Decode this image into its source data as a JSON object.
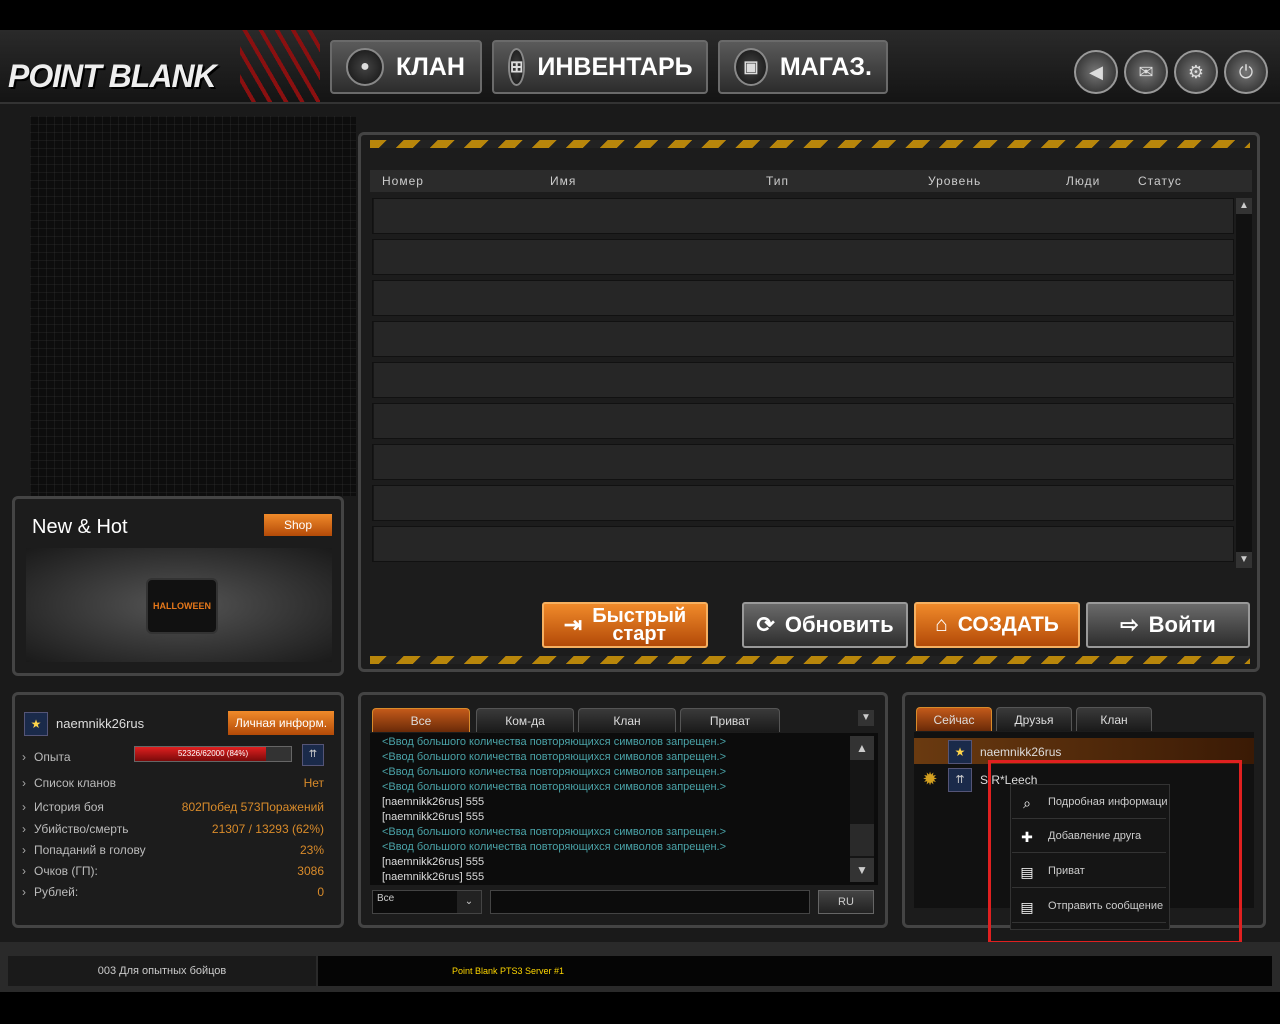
{
  "header": {
    "logo": "POINT BLANK",
    "nav": [
      {
        "label": "КЛАН",
        "icon": "user-icon"
      },
      {
        "label": "ИНВЕНТАРЬ",
        "icon": "cart-icon"
      },
      {
        "label": "МАГАЗ.",
        "icon": "briefcase-icon"
      }
    ],
    "round_buttons": [
      "back-arrow-icon",
      "mail-icon",
      "gear-icon",
      "power-icon"
    ]
  },
  "room_list": {
    "columns": [
      "Номер",
      "Имя",
      "Тип",
      "Уровень",
      "Люди",
      "Статус"
    ]
  },
  "actions": {
    "quick_start_line1": "Быстрый",
    "quick_start_line2": "старт",
    "refresh": "Обновить",
    "create": "СОЗДАТЬ",
    "enter": "Войти"
  },
  "new_hot": {
    "title": "New & Hot",
    "shop_button": "Shop",
    "banner_text": "HALLOWEEN"
  },
  "player": {
    "name": "naemnikk26rus",
    "info_button": "Личная информ.",
    "stats": [
      {
        "label": "Опыта",
        "value": ""
      },
      {
        "label": "Список кланов",
        "value": "Нет"
      },
      {
        "label": "История боя",
        "value": "802Побед 573Поражений"
      },
      {
        "label": "Убийство/смерть",
        "value": "21307 / 13293 (62%)"
      },
      {
        "label": "Попаданий в голову",
        "value": "23%"
      },
      {
        "label": "Очков (ГП):",
        "value": "3086"
      },
      {
        "label": "Рублей:",
        "value": "0"
      }
    ],
    "exp_text": "52326/62000 (84%)",
    "exp_fraction": 0.84
  },
  "chat": {
    "tabs": [
      "Все",
      "Ком-да",
      "Клан",
      "Приват"
    ],
    "lines": [
      {
        "text": "<Ввод большого количества повторяющихся символов запрещен.>",
        "type": "sys"
      },
      {
        "text": "<Ввод большого количества повторяющихся символов запрещен.>",
        "type": "sys"
      },
      {
        "text": "<Ввод большого количества повторяющихся символов запрещен.>",
        "type": "sys"
      },
      {
        "text": "<Ввод большого количества повторяющихся символов запрещен.>",
        "type": "sys"
      },
      {
        "text": "[naemnikk26rus] 555",
        "type": "user"
      },
      {
        "text": "[naemnikk26rus] 555",
        "type": "user"
      },
      {
        "text": "<Ввод большого количества повторяющихся символов запрещен.>",
        "type": "sys"
      },
      {
        "text": "<Ввод большого количества повторяющихся символов запрещен.>",
        "type": "sys"
      },
      {
        "text": "[naemnikk26rus] 555",
        "type": "user"
      },
      {
        "text": "[naemnikk26rus] 555",
        "type": "user"
      }
    ],
    "channel_select": "Все",
    "lang_button": "RU"
  },
  "friends": {
    "tabs": [
      "Сейчас",
      "Друзья",
      "Клан"
    ],
    "users": [
      "naemnikk26rus",
      "S.R*Leech"
    ],
    "context_menu": [
      {
        "label": "Подробная информаци",
        "icon": "search-icon"
      },
      {
        "label": "Добавление друга",
        "icon": "plus-icon"
      },
      {
        "label": "Приват",
        "icon": "document-icon"
      },
      {
        "label": "Отправить сообщение",
        "icon": "document-icon"
      }
    ]
  },
  "status_bar": {
    "channel": "003 Для опытных бойцов",
    "server": "Point Blank PTS3 Server #1"
  },
  "colors": {
    "accent_orange": "#d98b2a",
    "system_message": "#4aa3a8",
    "highlight_red": "#e02020"
  }
}
